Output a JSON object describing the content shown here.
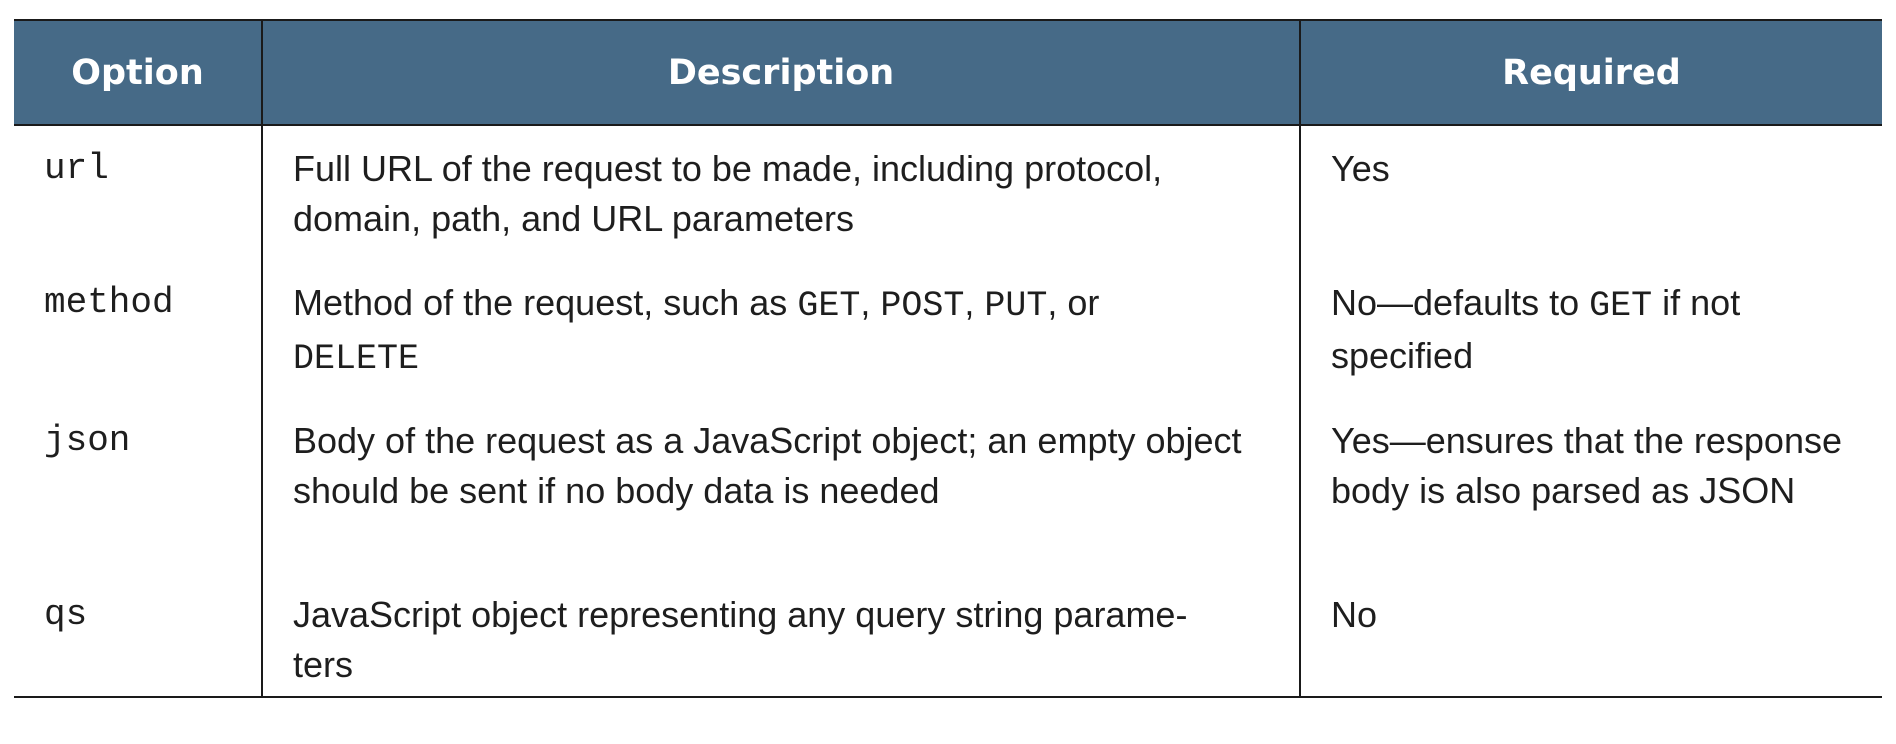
{
  "headers": {
    "option": "Option",
    "description": "Description",
    "required": "Required"
  },
  "rows": [
    {
      "option": "url",
      "description": {
        "text": "Full URL of the request to be made, including protocol, domain, path, and URL parameters"
      },
      "required": {
        "text": "Yes"
      }
    },
    {
      "option": "method",
      "description": {
        "prefix": "Method of the request, such as ",
        "code1": "GET",
        "sep1": ", ",
        "code2": "POST",
        "sep2": ", ",
        "code3": "PUT",
        "sep3": ", or ",
        "code4": "DELETE"
      },
      "required": {
        "prefix": "No—defaults to ",
        "code": "GET",
        "suffix": " if not specified"
      }
    },
    {
      "option": "json",
      "description": {
        "text": "Body of the request as a JavaScript object; an empty object should be sent if no body data is needed"
      },
      "required": {
        "text": "Yes—ensures that the response body is also parsed as JSON"
      }
    },
    {
      "option": "qs",
      "description": {
        "line1": "JavaScript object representing any query string parame-",
        "line2": "ters"
      },
      "required": {
        "text": "No"
      }
    }
  ],
  "colors": {
    "header_background": "#466a87",
    "header_text": "#ffffff",
    "body_text": "#1e1e1e",
    "rule": "#1a1a1a"
  }
}
